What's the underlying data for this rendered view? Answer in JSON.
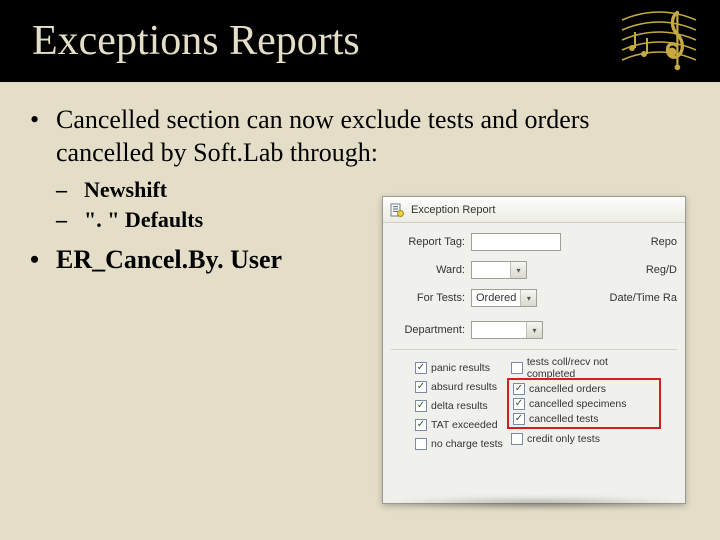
{
  "title": "Exceptions Reports",
  "bullets": {
    "b1": "Cancelled section can now exclude tests and orders cancelled by Soft.Lab through:",
    "sub1": "Newshift",
    "sub2": "\". \" Defaults",
    "b2": "ER_Cancel.By. User"
  },
  "panel": {
    "title": "Exception Report",
    "labels": {
      "report_tag": "Report Tag:",
      "report_right": "Repo",
      "ward": "Ward:",
      "reg_right": "Reg/D",
      "for_tests": "For Tests:",
      "for_tests_value": "Ordered",
      "dtr_right": "Date/Time Ra",
      "department": "Department:"
    },
    "checks": {
      "col1": [
        {
          "label": "panic results",
          "checked": true
        },
        {
          "label": "absurd results",
          "checked": true
        },
        {
          "label": "delta results",
          "checked": true
        },
        {
          "label": "TAT exceeded",
          "checked": true
        },
        {
          "label": "no charge tests",
          "checked": false
        }
      ],
      "col2_top": {
        "label": "tests coll/recv not completed",
        "checked": false
      },
      "col2_hl": [
        {
          "label": "cancelled orders",
          "checked": true
        },
        {
          "label": "cancelled specimens",
          "checked": true
        },
        {
          "label": "cancelled tests",
          "checked": true
        }
      ],
      "col2_bottom": {
        "label": "credit only tests",
        "checked": false
      }
    }
  }
}
